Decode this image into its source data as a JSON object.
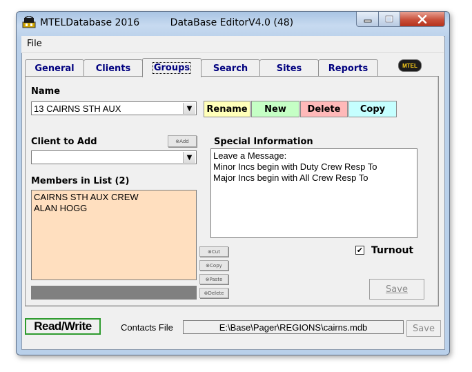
{
  "window": {
    "app_name": "MTELDatabase 2016",
    "editor_title": "DataBase EditorV4.0 (48)"
  },
  "menu": {
    "file": "File"
  },
  "tabs": [
    {
      "label": "General"
    },
    {
      "label": "Clients"
    },
    {
      "label": "Groups",
      "active": true
    },
    {
      "label": "Search"
    },
    {
      "label": "Sites"
    },
    {
      "label": "Reports"
    }
  ],
  "logo_text": "MTEL",
  "groups": {
    "name_label": "Name",
    "name_value": "13 CAIRNS STH AUX",
    "buttons": {
      "rename": "Rename",
      "new": "New",
      "delete": "Delete",
      "copy": "Copy"
    },
    "client_to_add_label": "Client to Add",
    "client_to_add_value": "",
    "add_button": "Add",
    "members_label": "Members in List (2)",
    "members": [
      "CAIRNS STH AUX CREW",
      "ALAN HOGG"
    ],
    "edit_buttons": {
      "cut": "Cut",
      "copy": "Copy",
      "paste": "Paste",
      "delete": "Delete"
    },
    "special_info_label": "Special Information",
    "special_info_lines": [
      "Leave a Message:",
      "Minor Incs begin with Duty Crew Resp To",
      "Major Incs begin with All Crew Resp To"
    ],
    "turnout_label": "Turnout",
    "turnout_checked": true,
    "save_label": "Save"
  },
  "footer": {
    "mode": "Read/Write",
    "contacts_label": "Contacts File",
    "contacts_path": "E:\\Base\\Pager\\REGIONS\\cairns.mdb",
    "save_label": "Save"
  },
  "colors": {
    "rename_bg": "#ffffb9",
    "new_bg": "#c5ffc5",
    "delete_bg": "#ffb9b9",
    "copy_bg": "#c5ffff",
    "members_bg": "#ffdfbf",
    "readwrite_border": "#2e9b2e",
    "tab_text": "#00007f"
  }
}
